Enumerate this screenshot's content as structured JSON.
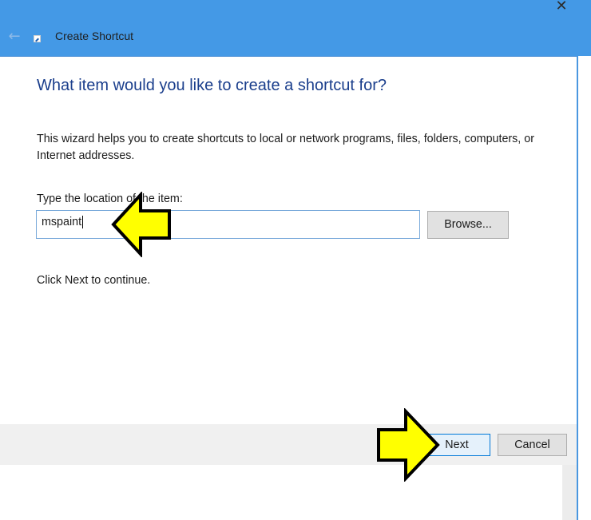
{
  "window": {
    "title": "Create Shortcut",
    "title_bar_color": "#4499e6"
  },
  "icons": {
    "back": "back-arrow-icon",
    "app": "shortcut-icon",
    "close": "close-icon"
  },
  "content": {
    "heading": "What item would you like to create a shortcut for?",
    "description": "This wizard helps you to create shortcuts to local or network programs, files, folders, computers, or Internet addresses.",
    "location_label": "Type the location of the item:",
    "location_value": "mspaint",
    "browse_label": "Browse...",
    "continue_text": "Click Next to continue."
  },
  "footer": {
    "next_label": "Next",
    "cancel_label": "Cancel"
  },
  "annotations": {
    "arrow_color": "#ffff00",
    "arrow_outline": "#000000"
  }
}
